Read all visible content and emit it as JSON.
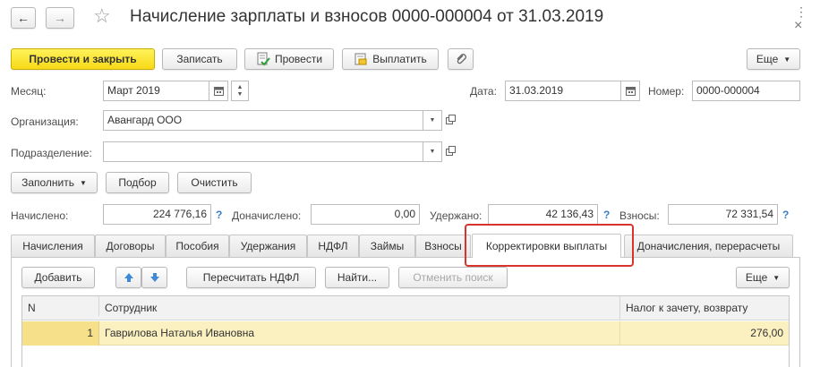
{
  "window": {
    "title": "Начисление зарплаты и взносов 0000-000004 от 31.03.2019",
    "back_icon": "←",
    "forward_icon": "→",
    "star_icon": "☆",
    "menu_icon": "⋮",
    "close_icon": "×"
  },
  "toolbar": {
    "post_close": "Провести и закрыть",
    "save": "Записать",
    "post": "Провести",
    "pay": "Выплатить",
    "more": "Еще"
  },
  "header": {
    "month_label": "Месяц:",
    "month_value": "Март 2019",
    "date_label": "Дата:",
    "date_value": "31.03.2019",
    "number_label": "Номер:",
    "number_value": "0000-000004",
    "org_label": "Организация:",
    "org_value": "Авангард ООО",
    "dept_label": "Подразделение:",
    "dept_value": ""
  },
  "actions": {
    "fill": "Заполнить",
    "select": "Подбор",
    "clear": "Очистить"
  },
  "totals": {
    "accrued_label": "Начислено:",
    "accrued_value": "224 776,16",
    "extra_label": "Доначислено:",
    "extra_value": "0,00",
    "withheld_label": "Удержано:",
    "withheld_value": "42 136,43",
    "contrib_label": "Взносы:",
    "contrib_value": "72 331,54",
    "help": "?"
  },
  "tabs": [
    {
      "label": "Начисления"
    },
    {
      "label": "Договоры"
    },
    {
      "label": "Пособия"
    },
    {
      "label": "Удержания"
    },
    {
      "label": "НДФЛ"
    },
    {
      "label": "Займы"
    },
    {
      "label": "Взносы"
    },
    {
      "label": "Корректировки выплаты"
    },
    {
      "label": "Доначисления, перерасчеты"
    }
  ],
  "tab_toolbar": {
    "add": "Добавить",
    "recalc": "Пересчитать НДФЛ",
    "find": "Найти...",
    "cancel_search": "Отменить поиск",
    "more": "Еще"
  },
  "table": {
    "columns": [
      "N",
      "Сотрудник",
      "Налог к зачету, возврату"
    ],
    "rows": [
      {
        "n": "1",
        "employee": "Гаврилова Наталья Ивановна",
        "tax": "276,00"
      }
    ]
  },
  "colors": {
    "primary_button": "#f7d916",
    "highlight_box": "#d9342b",
    "selected_row": "#fbf0c0",
    "help": "#3a7ec4"
  }
}
